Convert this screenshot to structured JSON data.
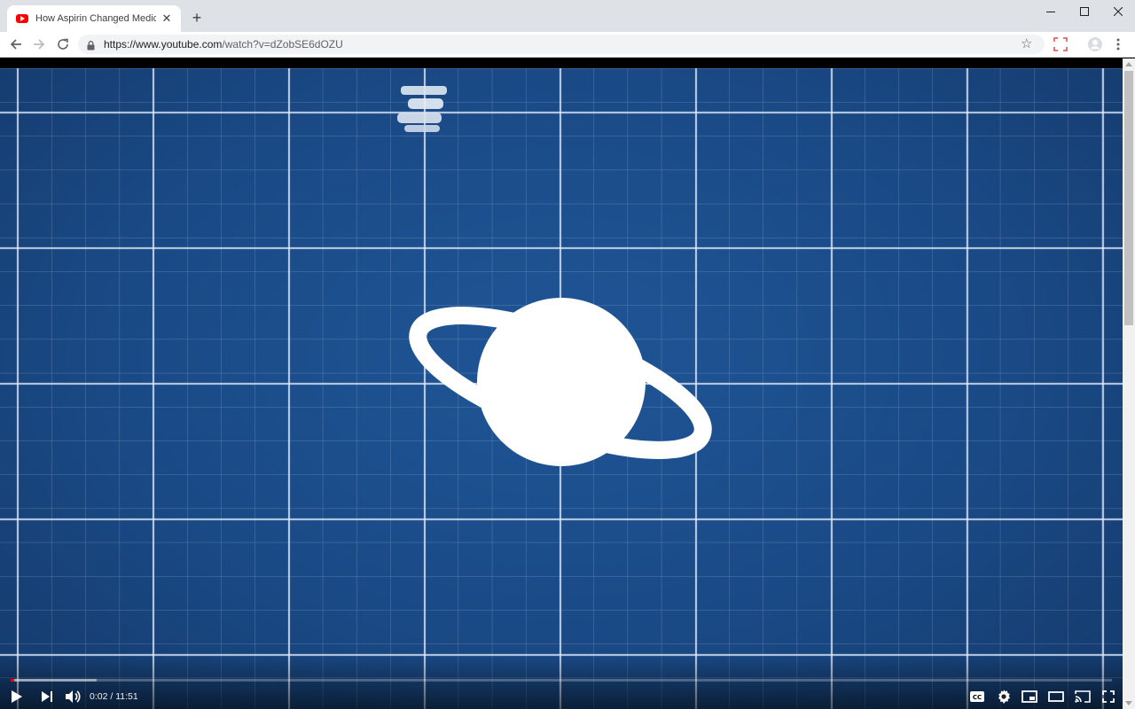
{
  "browser": {
    "tab": {
      "title": "How Aspirin Changed Medicine | ",
      "favicon": "youtube-icon"
    },
    "url": {
      "host": "https://www.youtube.com",
      "path": "/watch?v=dZobSE6dOZU"
    },
    "icons": {
      "back": "arrow-left-icon",
      "forward": "arrow-right-icon",
      "reload": "reload-icon",
      "lock": "lock-icon",
      "bookmark": "star-icon",
      "menu": "kebab-menu-icon"
    }
  },
  "player": {
    "current_time": "0:02",
    "separator": " / ",
    "duration": "11:51",
    "played_fraction": 0.003,
    "buffered_fraction": 0.078,
    "colors": {
      "played": "#ff0000",
      "grid_background": "#1a4a86"
    }
  }
}
